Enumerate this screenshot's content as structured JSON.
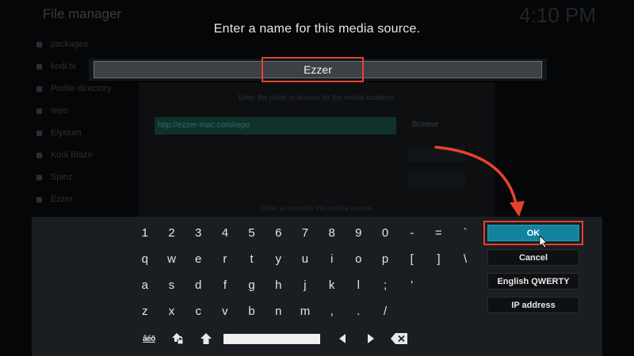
{
  "background": {
    "title": "File manager",
    "clock": "4:10 PM",
    "list_items": [
      "packages",
      "kodi.tv",
      "Profile directory",
      "repo",
      "Elysium",
      "Kodi Blaze",
      "Spinz",
      "Ezzer"
    ],
    "dialog": {
      "hint": "Enter the paths or browse for the media locations.",
      "url": "http://ezzer-mac.com/repo",
      "browse_label": "Browse",
      "footer_hint": "Enter a name for this media source."
    }
  },
  "prompt": "Enter a name for this media source.",
  "input": {
    "value": "Ezzer"
  },
  "keyboard": {
    "rows": [
      [
        "1",
        "2",
        "3",
        "4",
        "5",
        "6",
        "7",
        "8",
        "9",
        "0",
        "-",
        "=",
        "`"
      ],
      [
        "q",
        "w",
        "e",
        "r",
        "t",
        "y",
        "u",
        "i",
        "o",
        "p",
        "[",
        "]",
        "\\"
      ],
      [
        "a",
        "s",
        "d",
        "f",
        "g",
        "h",
        "j",
        "k",
        "l",
        ";",
        "'"
      ],
      [
        "z",
        "x",
        "c",
        "v",
        "b",
        "n",
        "m",
        ",",
        ".",
        "/"
      ]
    ],
    "special": {
      "symbols_label": "âéö",
      "caps_icon": "caps-lock-icon",
      "shift_icon": "shift-arrow-icon",
      "left_icon": "arrow-left-icon",
      "right_icon": "arrow-right-icon",
      "backspace_icon": "backspace-icon"
    },
    "buttons": {
      "ok": "OK",
      "cancel": "Cancel",
      "layout": "English QWERTY",
      "ip": "IP address"
    }
  },
  "colors": {
    "accent": "#12839f",
    "highlight": "#e8412b",
    "panel": "#1a1d21"
  }
}
